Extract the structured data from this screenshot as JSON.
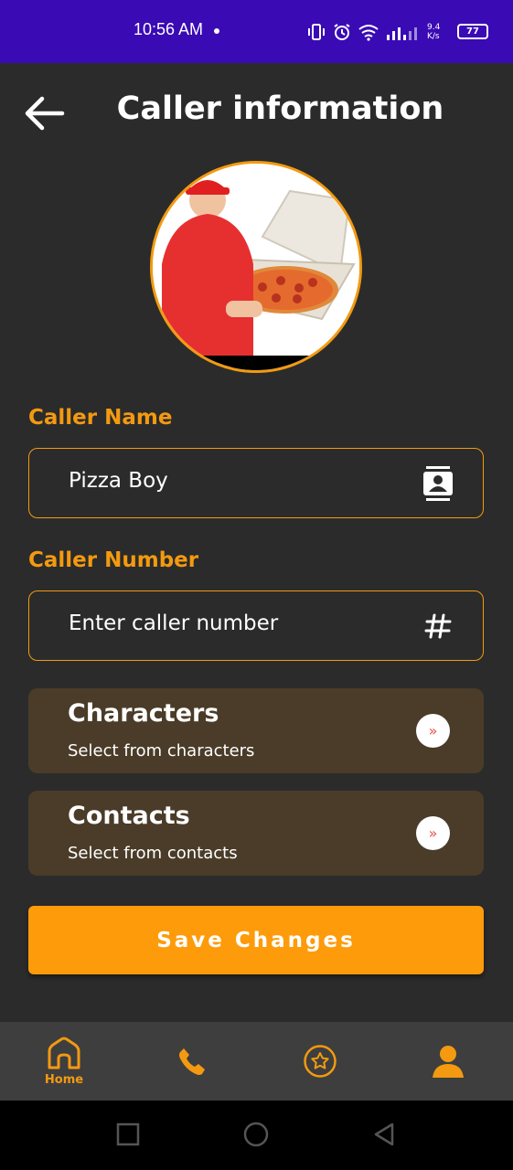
{
  "status_bar": {
    "time": "10:56 AM",
    "net_speed": "9.4 K/s",
    "battery": "77",
    "background": "#3a0ab5"
  },
  "header": {
    "title": "Caller information",
    "back_icon": "arrow-left-icon"
  },
  "avatar": {
    "alt": "pizza delivery boy holding pizza box"
  },
  "caller_name": {
    "label": "Caller Name",
    "value": "Pizza Boy",
    "icon": "contact-card-icon"
  },
  "caller_number": {
    "label": "Caller Number",
    "placeholder": "Enter caller number",
    "icon": "hash-icon"
  },
  "options": [
    {
      "title": "Characters",
      "subtitle": "Select from characters",
      "icon": "double-chevron-right-icon"
    },
    {
      "title": "Contacts",
      "subtitle": "Select from contacts",
      "icon": "double-chevron-right-icon"
    }
  ],
  "save_button": {
    "label": "Save Changes"
  },
  "bottom_nav": {
    "items": [
      {
        "label": "Home",
        "icon": "home-icon",
        "active": true
      },
      {
        "label": "",
        "icon": "phone-icon"
      },
      {
        "label": "",
        "icon": "star-circle-icon"
      },
      {
        "label": "",
        "icon": "user-icon"
      }
    ]
  },
  "colors": {
    "accent": "#f39a10",
    "button": "#fe9b0b",
    "background": "#2b2b2b",
    "card": "#4a3c28",
    "nav": "#3e3e3e"
  }
}
